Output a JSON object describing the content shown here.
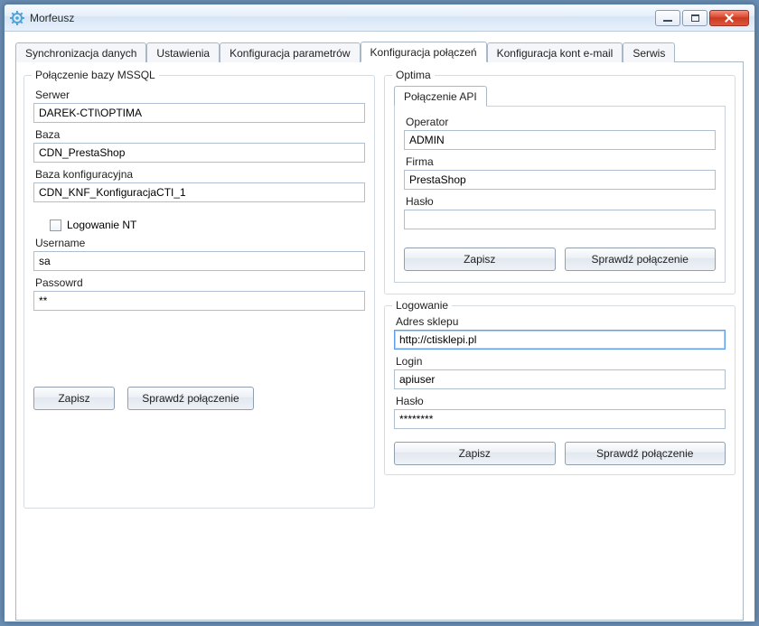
{
  "window": {
    "title": "Morfeusz"
  },
  "tabs": [
    {
      "label": "Synchronizacja danych"
    },
    {
      "label": "Ustawienia"
    },
    {
      "label": "Konfiguracja parametrów"
    },
    {
      "label": "Konfiguracja połączeń"
    },
    {
      "label": "Konfiguracja kont e-mail"
    },
    {
      "label": "Serwis"
    }
  ],
  "mssql": {
    "legend": "Połączenie bazy MSSQL",
    "server_label": "Serwer",
    "server_value": "DAREK-CTI\\OPTIMA",
    "db_label": "Baza",
    "db_value": "CDN_PrestaShop",
    "cfgdb_label": "Baza konfiguracyjna",
    "cfgdb_value": "CDN_KNF_KonfiguracjaCTI_1",
    "ntlog_label": "Logowanie NT",
    "user_label": "Username",
    "user_value": "sa",
    "pass_label": "Passowrd",
    "pass_value": "**",
    "save_label": "Zapisz",
    "test_label": "Sprawdź połączenie"
  },
  "optima": {
    "legend": "Optima",
    "api_legend": "Połączenie API",
    "operator_label": "Operator",
    "operator_value": "ADMIN",
    "firm_label": "Firma",
    "firm_value": "PrestaShop",
    "pass_label": "Hasło",
    "pass_value": "",
    "save_label": "Zapisz",
    "test_label": "Sprawdź połączenie"
  },
  "login": {
    "legend": "Logowanie",
    "addr_label": "Adres sklepu",
    "addr_value": "http://ctisklepi.pl",
    "login_label": "Login",
    "login_value": "apiuser",
    "pass_label": "Hasło",
    "pass_value": "********",
    "save_label": "Zapisz",
    "test_label": "Sprawdź połączenie"
  }
}
